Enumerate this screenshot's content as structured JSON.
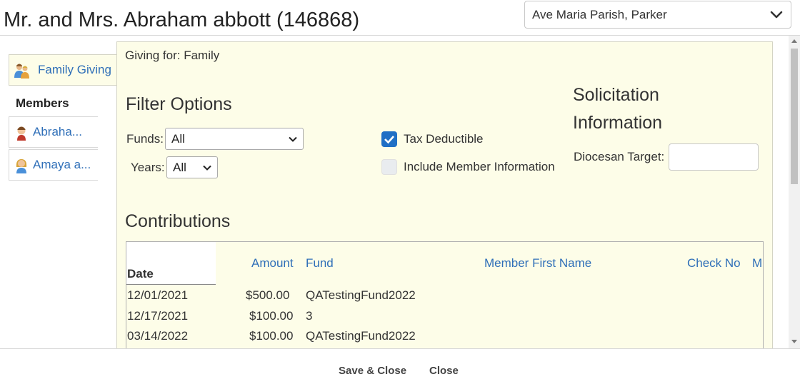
{
  "header": {
    "title": "Mr. and Mrs. Abraham abbott (146868)",
    "parish_select": "Ave Maria Parish, Parker"
  },
  "sidebar": {
    "family_giving_label": "Family Giving",
    "members_heading": "Members",
    "members": [
      {
        "label": "Abraha..."
      },
      {
        "label": "Amaya a..."
      }
    ]
  },
  "main": {
    "giving_for": "Giving for: Family",
    "filter_heading": "Filter Options",
    "funds_label": "Funds:",
    "funds_value": "All",
    "years_label": "Years:",
    "years_value": "All",
    "tax_deductible_label": "Tax Deductible",
    "tax_deductible_checked": true,
    "include_member_label": "Include Member Information",
    "include_member_checked": false,
    "solicitation_heading": "Solicitation Information",
    "diocesan_target_label": "Diocesan Target:",
    "diocesan_target_value": "",
    "contributions_heading": "Contributions"
  },
  "contributions": {
    "columns": [
      "Date",
      "Amount",
      "Fund",
      "Member First Name",
      "Check No",
      "M"
    ],
    "rows": [
      {
        "date": "12/01/2021",
        "amount": "$500.00",
        "fund": "QATestingFund2022"
      },
      {
        "date": "12/17/2021",
        "amount": "$100.00",
        "fund": "3"
      },
      {
        "date": "03/14/2022",
        "amount": "$100.00",
        "fund": "QATestingFund2022"
      }
    ]
  },
  "footer": {
    "save_close_label": "Save & Close",
    "close_label": "Close"
  },
  "colors": {
    "link": "#2f6fb8",
    "panel_bg": "#fdfde8",
    "checkbox_on": "#1f6fc5"
  }
}
